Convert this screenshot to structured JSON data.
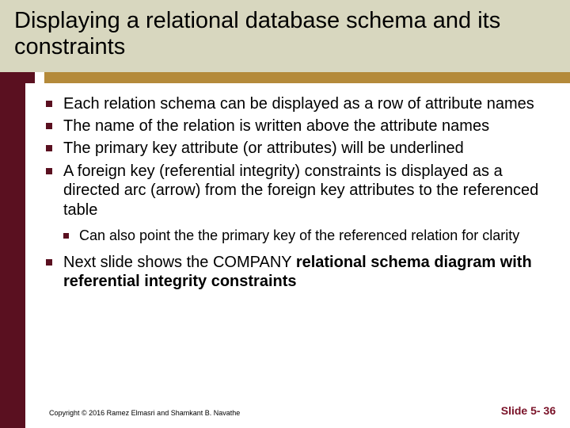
{
  "title": "Displaying a relational database schema and its constraints",
  "bullets": [
    "Each relation schema can be displayed as a row of attribute names",
    "The name of the relation is written above the attribute names",
    "The primary key attribute (or attributes) will be underlined",
    "A foreign key (referential integrity) constraints is displayed as a directed arc (arrow) from the foreign key attributes to the referenced table"
  ],
  "sub_bullet": "Can also point the the primary key of the referenced relation for clarity",
  "last_bullet_prefix": "Next slide shows the COMPANY ",
  "last_bullet_bold": "relational schema diagram with referential integrity constraints",
  "copyright": "Copyright © 2016 Ramez Elmasri and Shamkant B. Navathe",
  "slide_number": "Slide 5- 36"
}
